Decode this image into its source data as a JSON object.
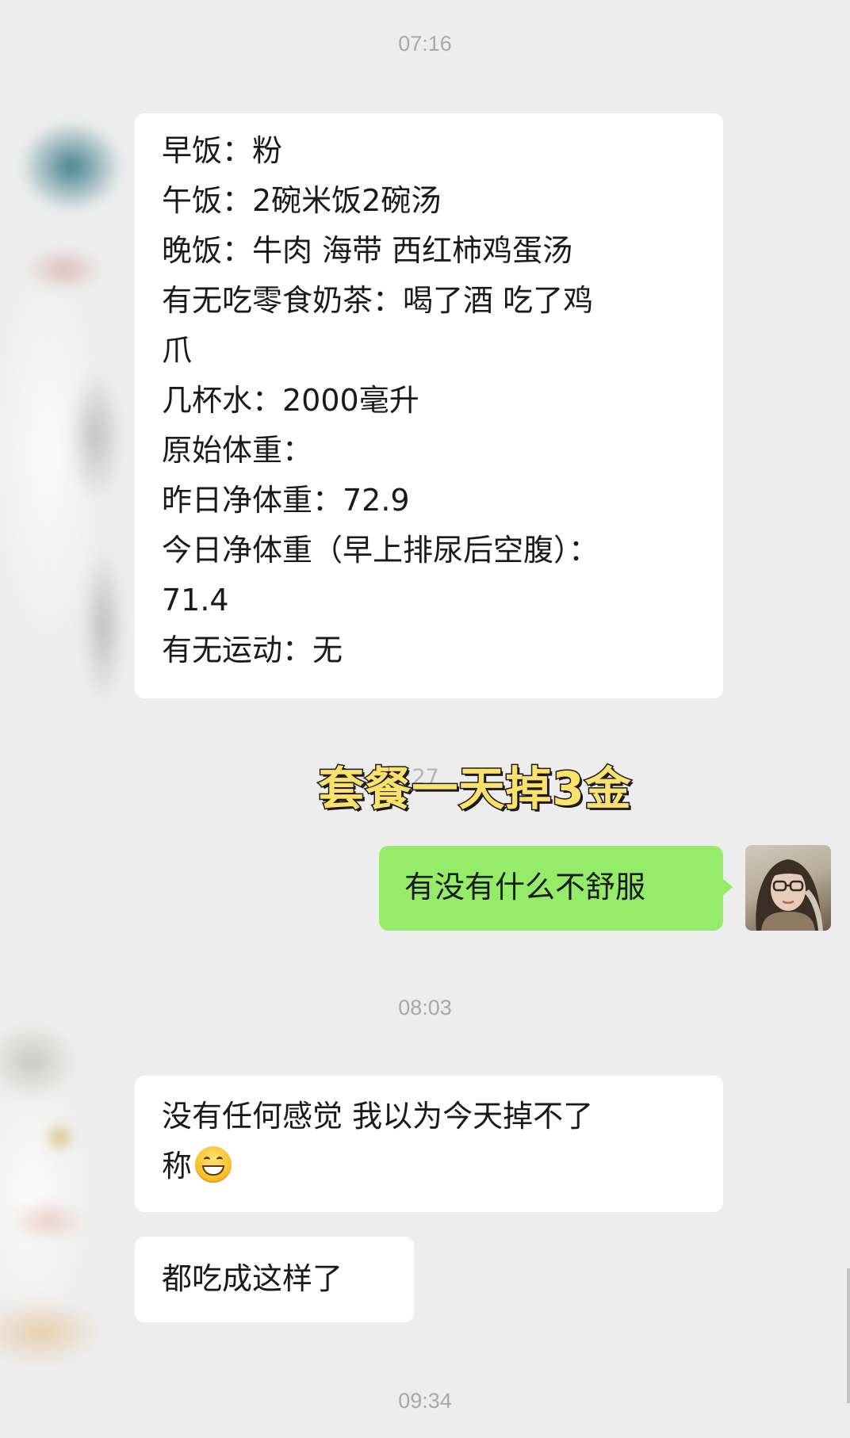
{
  "timestamps": {
    "first": "07:16",
    "second": "08:03",
    "third": "09:34"
  },
  "overlay": {
    "caption": "套餐一天掉3金",
    "faint_time": "07:27"
  },
  "messages": {
    "diet_log": {
      "lines": [
        "早饭：粉",
        "午饭：2碗米饭2碗汤",
        "晚饭：牛肉 海带 西红柿鸡蛋汤",
        "有无吃零食奶茶：喝了酒 吃了鸡",
        "爪",
        "几杯水：2000毫升",
        "原始体重：",
        "昨日净体重：72.9",
        "今日净体重（早上排尿后空腹）：",
        "71.4",
        "有无运动：无"
      ]
    },
    "outgoing": {
      "text": "有没有什么不舒服"
    },
    "no_feeling": {
      "line1": "没有任何感觉 我以为今天掉不了",
      "line2": "称",
      "emoji": "grinning-face-icon"
    },
    "eaten": {
      "text": "都吃成这样了"
    }
  },
  "colors": {
    "background": "#ededed",
    "incoming_bubble": "#ffffff",
    "outgoing_bubble": "#95ec69",
    "timestamp": "#a9a9a9",
    "caption_fill": "#fce26a"
  }
}
